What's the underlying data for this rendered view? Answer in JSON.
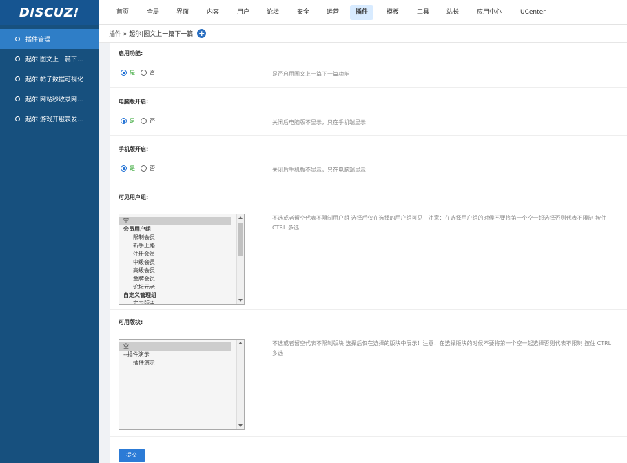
{
  "logo": "DISCUZ!",
  "sidebar": {
    "items": [
      {
        "label": "插件管理"
      },
      {
        "label": "起尔|图文上一篇下..."
      },
      {
        "label": "起尔|帖子数据可视化"
      },
      {
        "label": "起尔|网站秒收录网..."
      },
      {
        "label": "起尔|游戏开服表发..."
      }
    ]
  },
  "topnav": {
    "items": [
      {
        "label": "首页"
      },
      {
        "label": "全局"
      },
      {
        "label": "界面"
      },
      {
        "label": "内容"
      },
      {
        "label": "用户"
      },
      {
        "label": "论坛"
      },
      {
        "label": "安全"
      },
      {
        "label": "运营"
      },
      {
        "label": "插件"
      },
      {
        "label": "模板"
      },
      {
        "label": "工具"
      },
      {
        "label": "站长"
      },
      {
        "label": "应用中心"
      },
      {
        "label": "UCenter"
      }
    ],
    "active": "插件"
  },
  "breadcrumb": {
    "text": "插件 » 起尔|图文上一篇下一篇"
  },
  "form": {
    "enable": {
      "title": "启用功能:",
      "yes": "是",
      "no": "否",
      "desc": "是否启用图文上一篇下一篇功能"
    },
    "pc": {
      "title": "电脑版开启:",
      "yes": "是",
      "no": "否",
      "desc": "关闭后电脑版不显示，只在手机端显示"
    },
    "mobile": {
      "title": "手机版开启:",
      "yes": "是",
      "no": "否",
      "desc": "关闭后手机版不显示，只在电脑端显示"
    },
    "usergroups": {
      "title": "可见用户组:",
      "desc": "不选或者留空代表不限制用户组 选择后仅在选择的用户组可见！注意：在选择用户组的时候不要将第一个空一起选择否则代表不限制 按住 CTRL 多选",
      "options": [
        {
          "label": "空",
          "type": "sel"
        },
        {
          "label": "会员用户组",
          "type": "group"
        },
        {
          "label": "限制会员",
          "type": "child"
        },
        {
          "label": "新手上路",
          "type": "child"
        },
        {
          "label": "注册会员",
          "type": "child"
        },
        {
          "label": "中级会员",
          "type": "child"
        },
        {
          "label": "高级会员",
          "type": "child"
        },
        {
          "label": "金牌会员",
          "type": "child"
        },
        {
          "label": "论坛元老",
          "type": "child"
        },
        {
          "label": "自定义管理组",
          "type": "group"
        },
        {
          "label": "实习版主",
          "type": "child"
        }
      ]
    },
    "forums": {
      "title": "可用版块:",
      "desc": "不选或者留空代表不限制版块 选择后仅在选择的版块中展示！注意：在选择版块的时候不要将第一个空一起选择否则代表不限制 按住 CTRL 多选",
      "options": [
        {
          "label": "空",
          "type": "sel"
        },
        {
          "label": "--插件演示",
          "type": "plain"
        },
        {
          "label": "插件演示",
          "type": "child"
        }
      ]
    },
    "submit": "提交"
  }
}
